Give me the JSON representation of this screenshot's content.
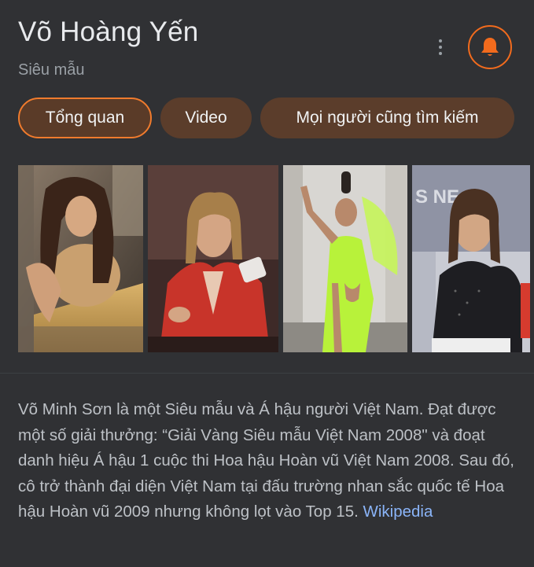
{
  "header": {
    "title": "Võ Hoàng Yến",
    "subtitle": "Siêu mẫu"
  },
  "actions": {
    "more_icon": "more-vert-icon",
    "bell_icon": "bell-icon",
    "accent_color": "#f26b1d"
  },
  "tabs": [
    {
      "label": "Tổng quan",
      "active": true
    },
    {
      "label": "Video",
      "active": false
    },
    {
      "label": "Mọi người cũng tìm kiếm",
      "active": false
    }
  ],
  "gallery": {
    "images": [
      {
        "name": "photo-gold-dress"
      },
      {
        "name": "photo-red-blazer"
      },
      {
        "name": "photo-neon-green-dress"
      },
      {
        "name": "photo-black-dress-studio"
      }
    ]
  },
  "description": {
    "text": "Võ Minh Sơn là một Siêu mẫu và Á hậu người Việt Nam. Đạt được một số giải thưởng: “Giải Vàng Siêu mẫu Việt Nam 2008\" và đoạt danh hiệu Á hậu 1 cuộc thi Hoa hậu Hoàn vũ Việt Nam 2008. Sau đó, cô trở thành đại diện Việt Nam tại đấu trường nhan sắc quốc tế Hoa hậu Hoàn vũ 2009 nhưng không lọt vào Top 15.",
    "source_link": "Wikipedia"
  }
}
